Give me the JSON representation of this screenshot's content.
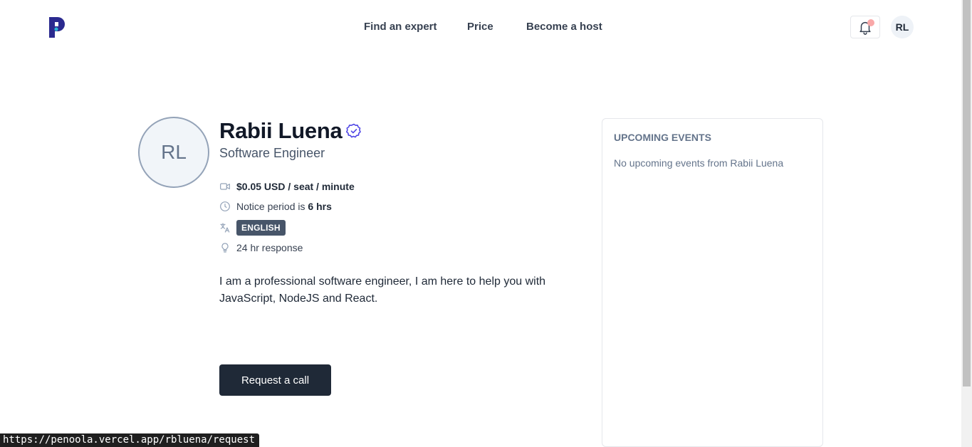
{
  "header": {
    "logo_icon": "penoola-logo-icon",
    "nav": [
      "Find an expert",
      "Price",
      "Become a host"
    ],
    "notifications_icon": "bell-icon",
    "user_initials": "RL"
  },
  "profile": {
    "initials": "RL",
    "name": "Rabii Luena",
    "verified_icon": "verified-badge-icon",
    "title": "Software Engineer",
    "rate": "$0.05 USD / seat / minute",
    "notice_prefix": "Notice period is",
    "notice_value": "6 hrs",
    "language": "ENGLISH",
    "response": "24 hr response",
    "bio": "I am a professional software engineer, I am here to help you with JavaScript, NodeJS and React.",
    "cta": "Request a call",
    "icons": [
      "video-icon",
      "clock-icon",
      "translate-icon",
      "lightbulb-icon"
    ]
  },
  "events": {
    "heading": "UPCOMING EVENTS",
    "empty_text": "No upcoming events from Rabii Luena"
  },
  "status_bar": {
    "url": "https://penoola.vercel.app/rbluena/request"
  },
  "colors": {
    "brand": "#2b2a8f",
    "brand_accent": "#2bb6d4",
    "cta_bg": "#1f2937",
    "badge_bg": "#475569",
    "verified": "#4f46e5"
  }
}
